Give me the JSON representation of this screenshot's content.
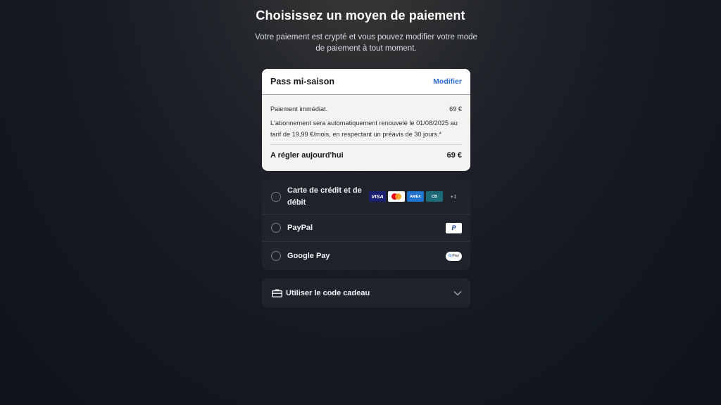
{
  "header": {
    "title": "Choisissez un moyen de paiement",
    "subtitle": "Votre paiement est crypté et vous pouvez modifier votre mode de paiement à tout moment."
  },
  "summary": {
    "plan_name": "Pass mi-saison",
    "modify_label": "Modifier",
    "immediate_label": "Paiement immédiat.",
    "immediate_amount": "69 €",
    "renewal_note": "L'abonnement sera automatiquement renouvelé le 01/08/2025 au tarif de 19,99 €/mois, en respectant un préavis de 30 jours.*",
    "total_label": "A régler aujourd'hui",
    "total_amount": "69 €"
  },
  "payment_methods": {
    "card_label": "Carte de crédit et de débit",
    "card_logos": {
      "visa": "VISA",
      "amex": "AMEX",
      "cb": "CB",
      "more": "+1"
    },
    "paypal_label": "PayPal",
    "paypal_logo": "P",
    "gpay_label": "Google Pay",
    "gpay_logo_g": "G",
    "gpay_logo_pay": "Pay"
  },
  "gift": {
    "label": "Utiliser le code cadeau"
  },
  "icons": {
    "gift": "gift-card-icon",
    "chevron": "chevron-down-icon"
  },
  "colors": {
    "accent_link": "#2f6fd1",
    "panel": "#1f232b",
    "summary_bg": "#f3f3f2"
  }
}
